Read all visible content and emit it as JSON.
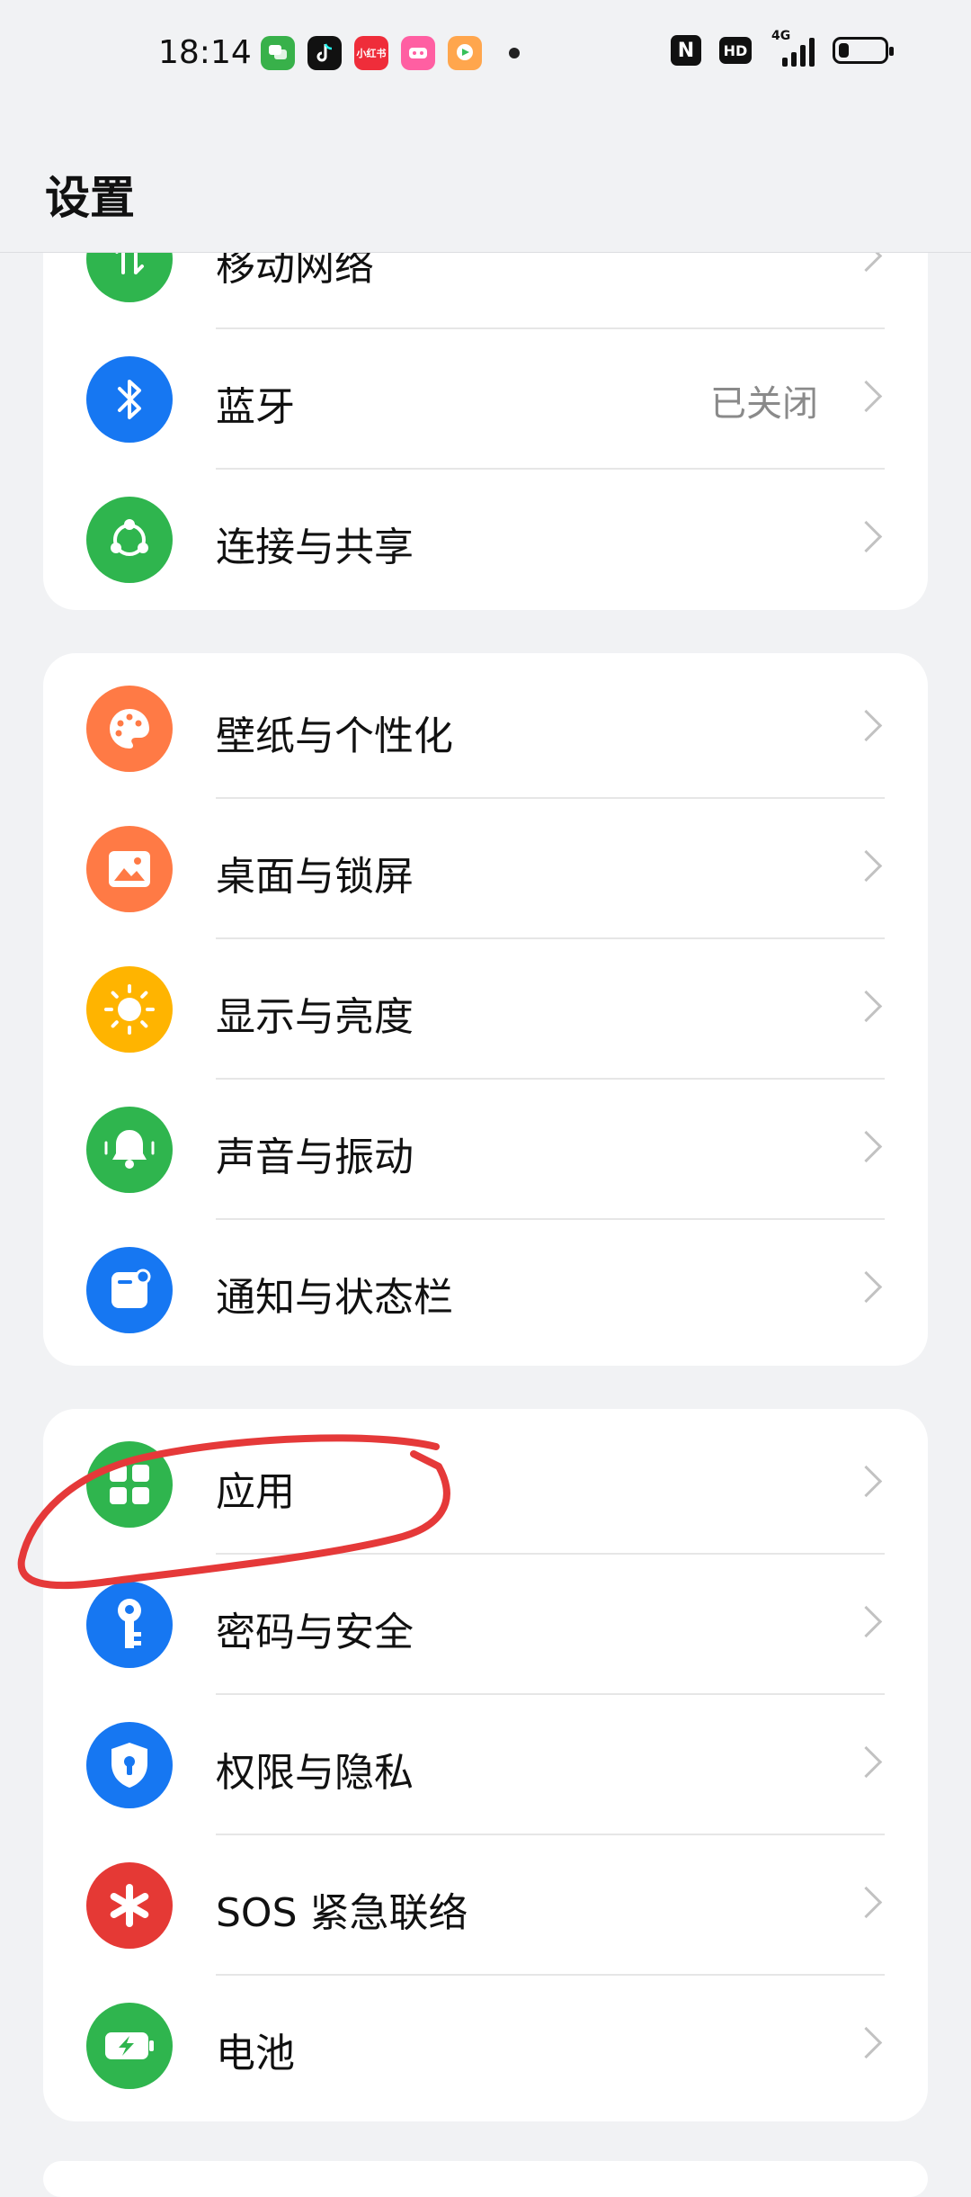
{
  "status_bar": {
    "time": "18:14",
    "notification_apps": [
      {
        "name": "messages-app-icon",
        "color": "#38b14a"
      },
      {
        "name": "tiktok-app-icon",
        "color": "#111111"
      },
      {
        "name": "xiaohongshu-app-icon",
        "color": "#ef2d3a"
      },
      {
        "name": "pink-app-icon",
        "color": "#ff5fa2"
      },
      {
        "name": "video-app-icon",
        "color": "#ffa64d"
      }
    ],
    "xiaohongshu_label": "小红书",
    "nfc_label": "N",
    "hd_label": "HD",
    "network_label": "4G",
    "battery_level": 0.22
  },
  "header": {
    "title": "设置"
  },
  "groups": [
    {
      "items": [
        {
          "key": "mobile-network",
          "label": "移动网络",
          "icon": "mobile-data-icon",
          "color": "#2fb54e",
          "value": ""
        },
        {
          "key": "bluetooth",
          "label": "蓝牙",
          "icon": "bluetooth-icon",
          "color": "#1677f2",
          "value": "已关闭"
        },
        {
          "key": "connection-sharing",
          "label": "连接与共享",
          "icon": "share-icon",
          "color": "#2fb54e",
          "value": ""
        }
      ]
    },
    {
      "items": [
        {
          "key": "wallpaper",
          "label": "壁纸与个性化",
          "icon": "palette-icon",
          "color": "#ff7a45",
          "value": ""
        },
        {
          "key": "home-lock-screen",
          "label": "桌面与锁屏",
          "icon": "picture-icon",
          "color": "#ff7a45",
          "value": ""
        },
        {
          "key": "display-brightness",
          "label": "显示与亮度",
          "icon": "sun-icon",
          "color": "#ffb400",
          "value": ""
        },
        {
          "key": "sound-vibration",
          "label": "声音与振动",
          "icon": "bell-icon",
          "color": "#2fb54e",
          "value": ""
        },
        {
          "key": "notification-status-bar",
          "label": "通知与状态栏",
          "icon": "notification-icon",
          "color": "#1677f2",
          "value": ""
        }
      ]
    },
    {
      "items": [
        {
          "key": "apps",
          "label": "应用",
          "icon": "apps-grid-icon",
          "color": "#2fb54e",
          "value": ""
        },
        {
          "key": "password-security",
          "label": "密码与安全",
          "icon": "key-icon",
          "color": "#1677f2",
          "value": ""
        },
        {
          "key": "permissions-privacy",
          "label": "权限与隐私",
          "icon": "shield-icon",
          "color": "#1677f2",
          "value": ""
        },
        {
          "key": "sos",
          "label": "SOS 紧急联络",
          "icon": "asterisk-icon",
          "color": "#e53935",
          "value": ""
        },
        {
          "key": "battery",
          "label": "电池",
          "icon": "battery-charge-icon",
          "color": "#2fb54e",
          "value": ""
        }
      ]
    }
  ],
  "annotation": {
    "color": "#e53939"
  }
}
